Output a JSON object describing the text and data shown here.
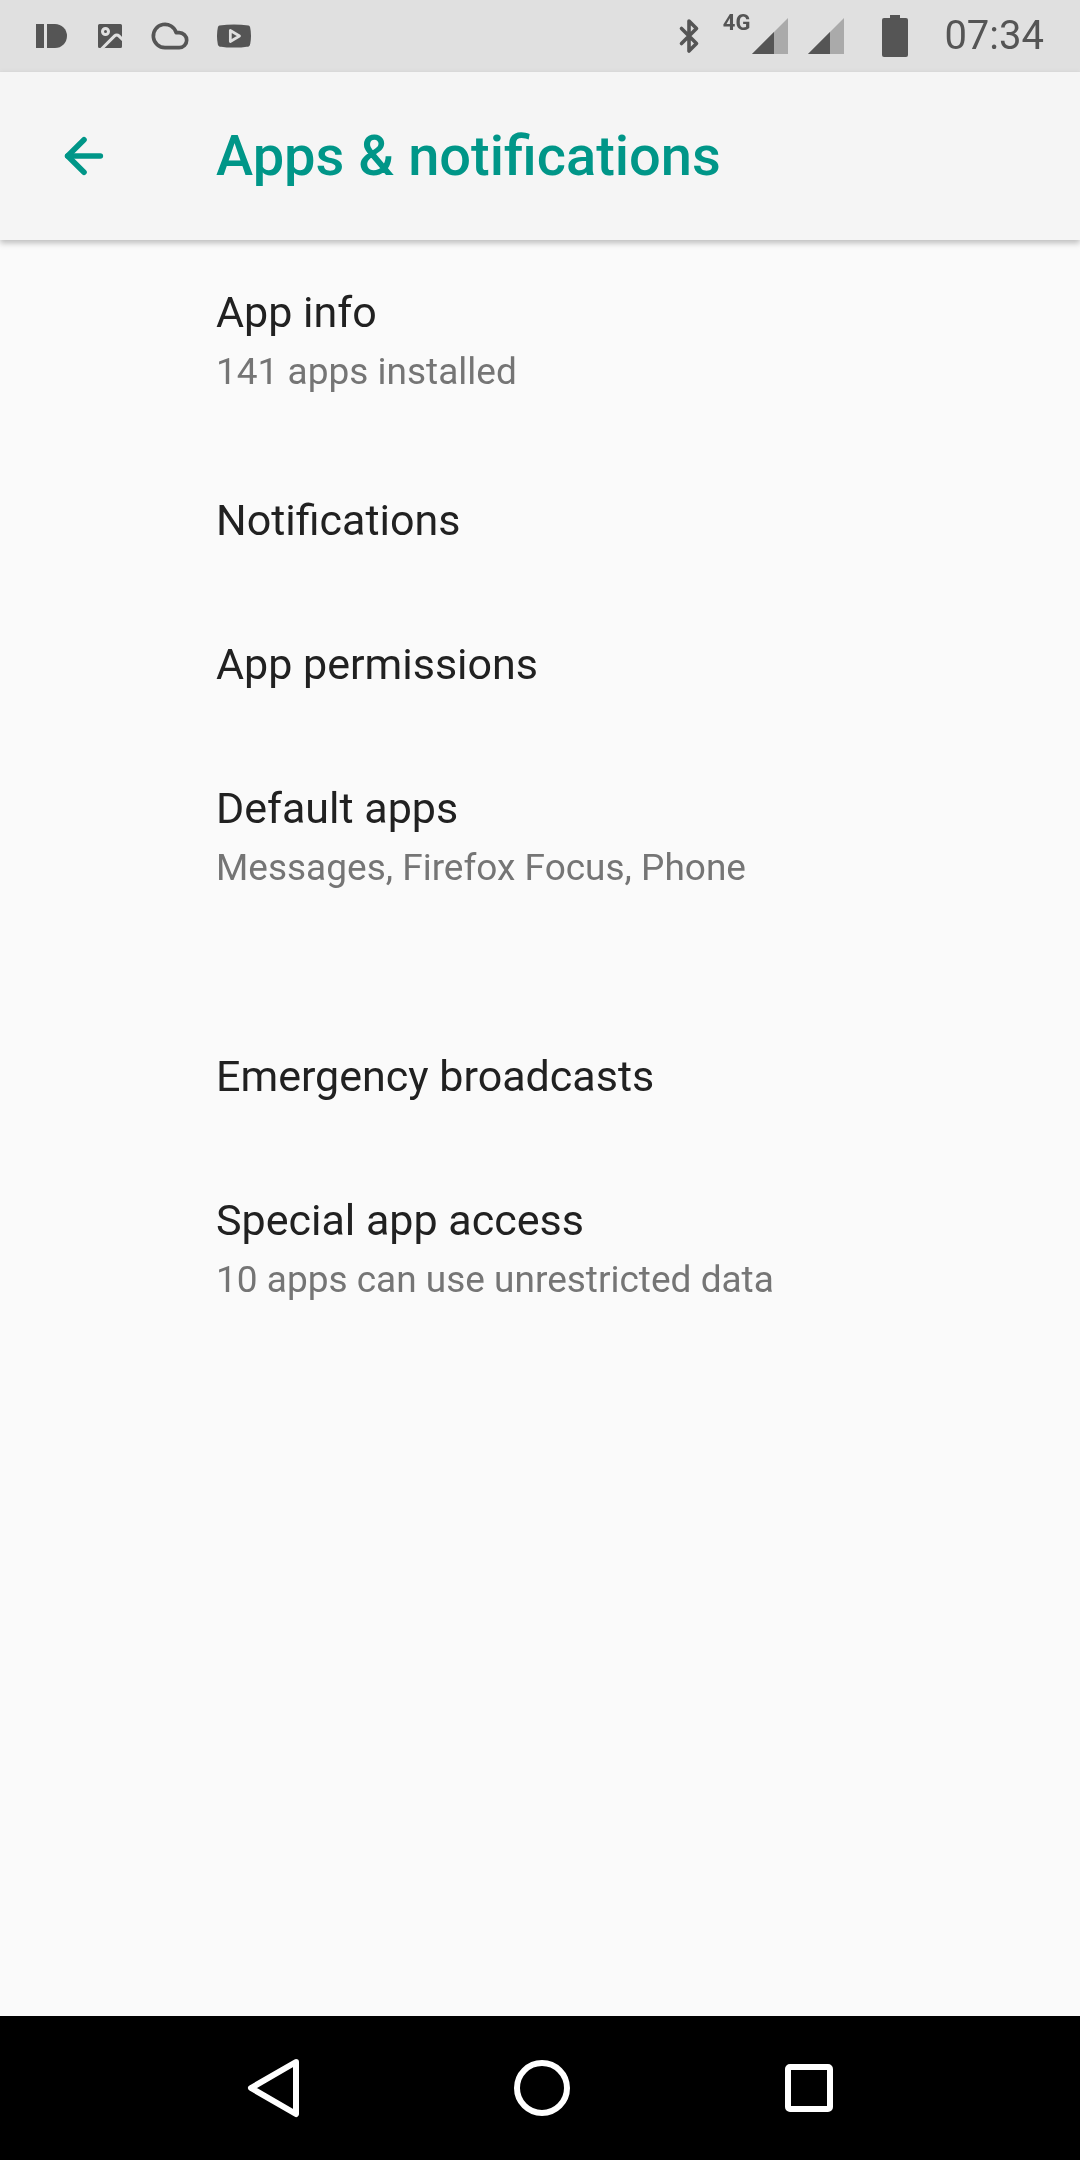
{
  "status_bar": {
    "network": "4G",
    "time": "07:34"
  },
  "app_bar": {
    "title": "Apps & notifications"
  },
  "sections": [
    [
      {
        "title": "App info",
        "summary": "141 apps installed"
      },
      {
        "title": "Notifications"
      },
      {
        "title": "App permissions"
      },
      {
        "title": "Default apps",
        "summary": "Messages, Firefox Focus, Phone"
      }
    ],
    [
      {
        "title": "Emergency broadcasts"
      },
      {
        "title": "Special app access",
        "summary": "10 apps can use unrestricted data"
      }
    ]
  ]
}
